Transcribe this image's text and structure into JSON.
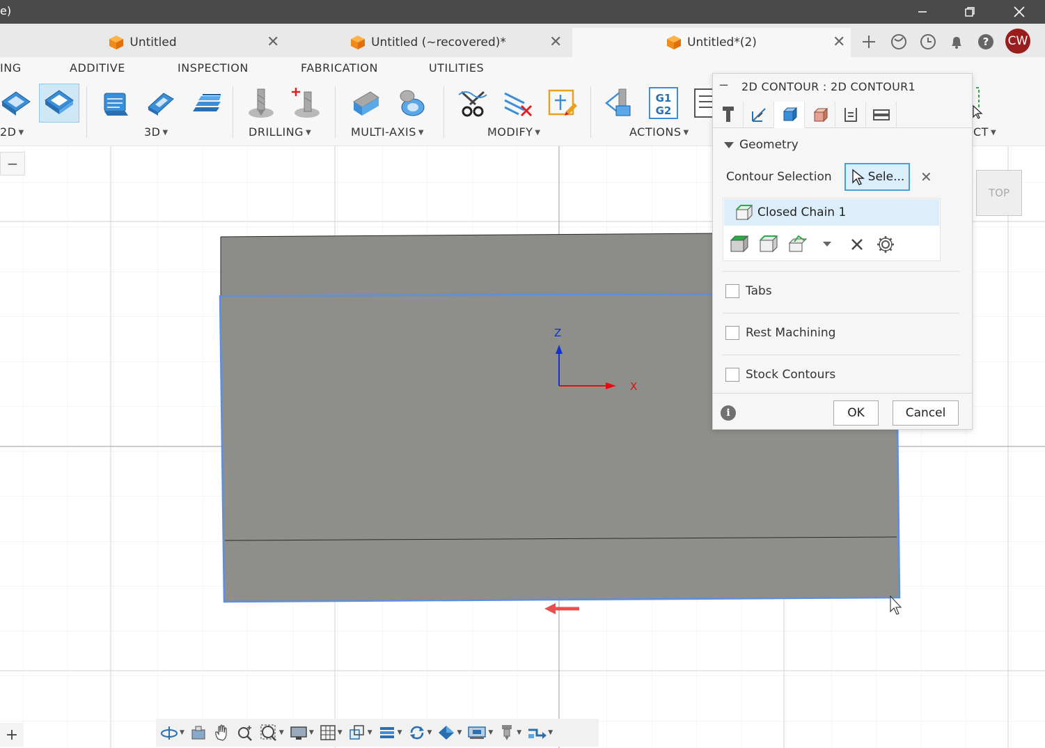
{
  "window": {
    "title": "e)",
    "minimize_icon": "minimize-icon",
    "restore_icon": "restore-icon",
    "close_icon": "close-icon"
  },
  "tabs": [
    {
      "label": "Untitled",
      "active": false
    },
    {
      "label": "Untitled (~recovered)*",
      "active": false
    },
    {
      "label": "Untitled*(2)",
      "active": true
    }
  ],
  "user": {
    "initials": "CW",
    "color": "#9b1c1c"
  },
  "ribbon": {
    "tabs": [
      "ING",
      "ADDITIVE",
      "INSPECTION",
      "FABRICATION",
      "UTILITIES"
    ],
    "groups": {
      "g2d": "2D",
      "g3d": "3D",
      "drilling": "DRILLING",
      "multiaxis": "MULTI-AXIS",
      "modify": "MODIFY",
      "actions": "ACTIONS",
      "select": "CT"
    },
    "g1g2_text": [
      "G1",
      "G2"
    ]
  },
  "viewport": {
    "collapse_label": "−",
    "viewcube_face": "TOP",
    "axis_z": "Z",
    "axis_x": "X",
    "add_label": "+"
  },
  "dialog": {
    "title": "2D CONTOUR : 2D CONTOUR1",
    "collapse_label": "−",
    "section_title": "Geometry",
    "contour_selection_label": "Contour Selection",
    "select_button": "Sele...",
    "chain_item": "Closed Chain 1",
    "tabs_label": "Tabs",
    "rest_machining_label": "Rest Machining",
    "stock_contours_label": "Stock Contours",
    "ok": "OK",
    "cancel": "Cancel"
  },
  "colors": {
    "accent": "#41a0e0",
    "selected_bg": "#dceefa",
    "part_gray": "#8e8e8a",
    "edge_blue": "#5b8fe0",
    "axis_red": "#e01010",
    "axis_blue": "#1030d0"
  }
}
